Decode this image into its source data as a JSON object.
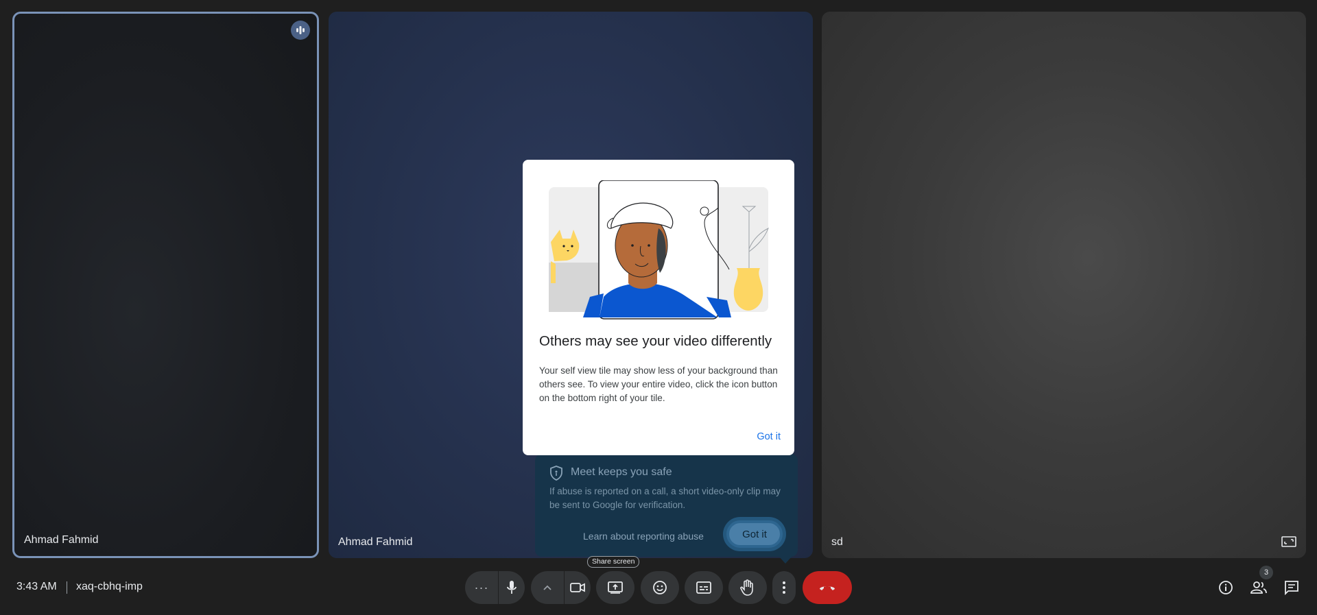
{
  "tiles": [
    {
      "name": "Ahmad Fahmid"
    },
    {
      "name": "Ahmad Fahmid"
    },
    {
      "name": "sd"
    }
  ],
  "dialog": {
    "title": "Others may see your video differently",
    "body": "Your self view tile may show less of your background than others see. To view your entire video, click the icon button on the bottom right of your tile.",
    "got_it": "Got it"
  },
  "safety": {
    "title": "Meet keeps you safe",
    "body": "If abuse is reported on a call, a short video-only clip may be sent to Google for verification.",
    "learn": "Learn about reporting abuse",
    "got_it": "Got it"
  },
  "bottom": {
    "time": "3:43 AM",
    "meeting_code": "xaq-cbhq-imp",
    "share_tooltip": "Share screen",
    "people_count": "3"
  },
  "colors": {
    "end_call": "#c5221f",
    "accent": "#8ab4f8",
    "link": "#1a73e8"
  },
  "icons": [
    "audio-options-icon",
    "mic-icon",
    "chevron-up-icon",
    "camera-icon",
    "present-icon",
    "emoji-icon",
    "captions-icon",
    "raise-hand-icon",
    "more-vert-icon",
    "end-call-icon",
    "info-icon",
    "people-icon",
    "chat-icon",
    "speaking-icon",
    "fit-frame-icon",
    "shield-icon"
  ]
}
